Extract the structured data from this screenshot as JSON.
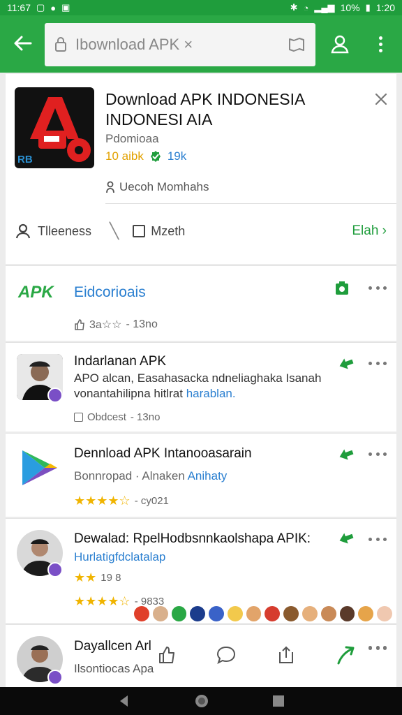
{
  "status_bar": {
    "time": "11:67",
    "battery": "10%",
    "clock_right": "1:20"
  },
  "search": {
    "value": "Ibownload APK ×"
  },
  "top_card": {
    "title": "Download APK INDONESIA INDONESI AIA",
    "subtitle": "Pdomioaa",
    "rating": "10 aibk",
    "version": "19k",
    "developer": "Uecoh Momhahs",
    "filter_label": "Tlleeness",
    "option_label": "Mzeth",
    "link_label": "Elah",
    "icon_text": "RB"
  },
  "feature_row": {
    "logo": "APK",
    "title": "Eidcorioais",
    "meta_rating": "3a☆☆",
    "meta_time": "- 13no"
  },
  "list": [
    {
      "title": "Indarlanan APK",
      "line1": "APO alcan, Easahasacka ndneliaghaka Isanah",
      "line2_plain": "vonantahilipna hitlrat",
      "line2_link": "harablan.",
      "meta": "Obdcest",
      "meta_time": "- 13no"
    },
    {
      "title": "Dennload APK Intanooasarain",
      "sub_plain": "Bonnropad · Alnaken",
      "sub_link": "Anihaty",
      "stars": "★★★★☆",
      "meta_time": "- cy021"
    },
    {
      "title": "Dewalad: RpelHodbsnnkaolshapa APIK:",
      "sub_link": "Hurlatigfdclatalap",
      "rating_small": "19 8",
      "stars": "★★★★☆",
      "meta_time": "- 9833"
    },
    {
      "title": "Dayallcen Arl",
      "sub_plain": "Ilsontiocas Apa"
    }
  ],
  "colors": {
    "accent": "#2aa845",
    "link": "#2a7fd0",
    "star": "#f0b400"
  }
}
